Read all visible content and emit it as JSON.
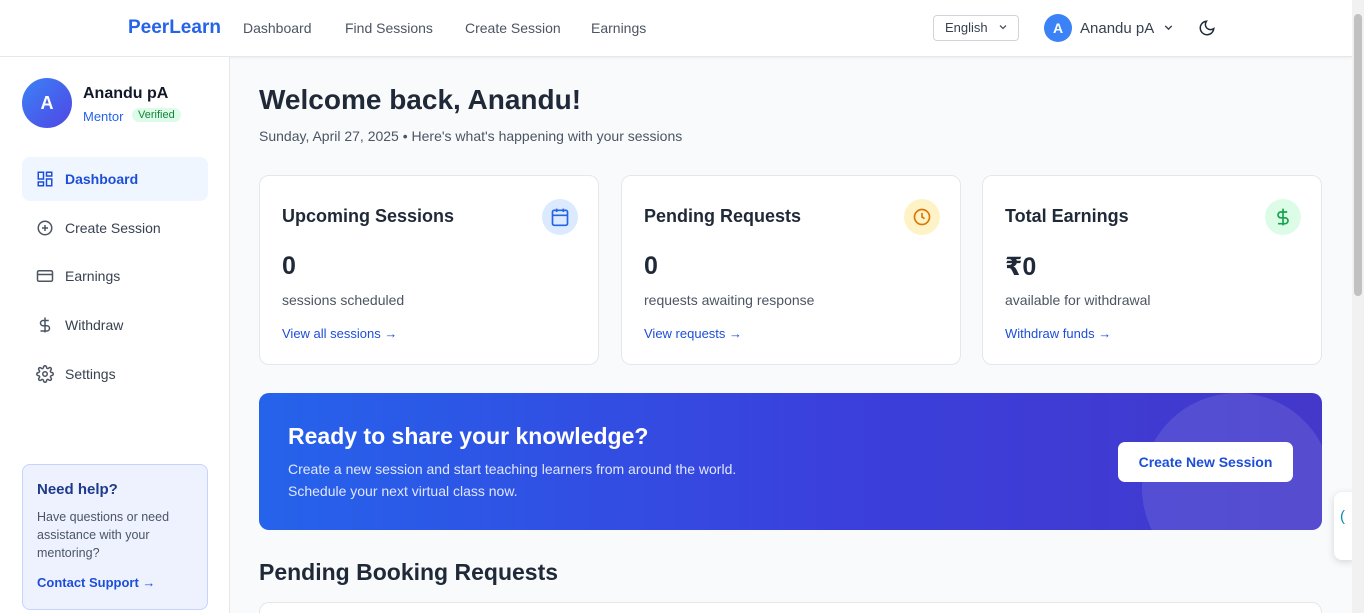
{
  "header": {
    "brand": "PeerLearn",
    "nav": [
      "Dashboard",
      "Find Sessions",
      "Create Session",
      "Earnings"
    ],
    "language": "English",
    "user_initial": "A",
    "user_name": "Anandu pA"
  },
  "sidebar": {
    "avatar_initial": "A",
    "name": "Anandu pA",
    "role": "Mentor",
    "badge": "Verified",
    "items": [
      {
        "label": "Dashboard",
        "icon": "grid-icon",
        "active": true
      },
      {
        "label": "Create Session",
        "icon": "plus-circle-icon"
      },
      {
        "label": "Earnings",
        "icon": "credit-card-icon"
      },
      {
        "label": "Withdraw",
        "icon": "dollar-icon"
      },
      {
        "label": "Settings",
        "icon": "gear-icon"
      }
    ],
    "help": {
      "title": "Need help?",
      "text": "Have questions or need assistance with your mentoring?",
      "link": "Contact Support →"
    }
  },
  "main": {
    "welcome": "Welcome back, Anandu!",
    "subline": "Sunday, April 27, 2025 • Here's what's happening with your sessions",
    "cards": [
      {
        "title": "Upcoming Sessions",
        "value": "0",
        "desc": "sessions scheduled",
        "link": "View all sessions →",
        "icon": "calendar-icon",
        "icon_bg": "#dbeafe",
        "icon_color": "#2563eb"
      },
      {
        "title": "Pending Requests",
        "value": "0",
        "desc": "requests awaiting response",
        "link": "View requests →",
        "icon": "clock-icon",
        "icon_bg": "#fef3c7",
        "icon_color": "#d97706"
      },
      {
        "title": "Total Earnings",
        "value": "₹0",
        "desc": "available for withdrawal",
        "link": "Withdraw funds →",
        "icon": "dollar-icon",
        "icon_bg": "#dcfce7",
        "icon_color": "#16a34a"
      }
    ],
    "banner": {
      "title": "Ready to share your knowledge?",
      "line1": "Create a new session and start teaching learners from around the world.",
      "line2": "Schedule your next virtual class now.",
      "button": "Create New Session"
    },
    "section_title": "Pending Booking Requests"
  },
  "colors": {
    "accent": "#2563eb",
    "brand": "#2563eb"
  }
}
